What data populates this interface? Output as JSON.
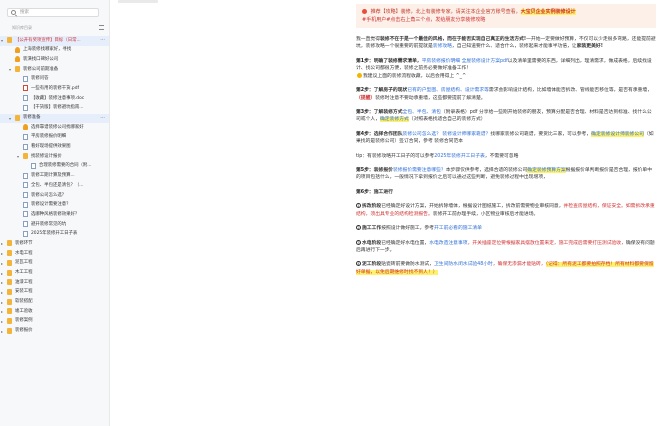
{
  "sidebar": {
    "search_placeholder": "搜索",
    "section_label": "知识库目录",
    "items": [
      {
        "label": "【公开有奖项宣传】目标（日常...",
        "icon": "folder-icon",
        "level": 0,
        "caret": "▾",
        "hl": true,
        "active": true
      },
      {
        "label": "上海装修找哪家好，寻找",
        "icon": "flame-icon",
        "level": 1
      },
      {
        "label": "装潢找口碑好公司",
        "icon": "flame-icon",
        "level": 1
      },
      {
        "label": "装修公司前期准备",
        "icon": "folder-icon",
        "level": 1,
        "caret": "▾"
      },
      {
        "label": "装修问答",
        "icon": "doc-icon",
        "level": 2
      },
      {
        "label": "一些有用的装修干货.pdf",
        "icon": "pdf-icon",
        "level": 2
      },
      {
        "label": "【收藏】装修注意事项.doc",
        "icon": "doc-icon",
        "level": 2
      },
      {
        "label": "【干货版】装修避坑指南...",
        "icon": "doc-icon",
        "level": 2
      },
      {
        "label": "装修准备",
        "icon": "folder-icon",
        "level": 1,
        "caret": "▾",
        "active": true
      },
      {
        "label": "选择靠谱装修公司找哪家好",
        "icon": "flame-icon",
        "level": 2
      },
      {
        "label": "平房装修报价明细",
        "icon": "doc-icon",
        "level": 2
      },
      {
        "label": "看好现场提供效果图",
        "icon": "doc-icon",
        "level": 2
      },
      {
        "label": "找装修设计报价",
        "icon": "folder-icon",
        "level": 2,
        "caret": "▾"
      },
      {
        "label": "合理装修需要的合同（附...",
        "icon": "doc-icon",
        "level": 3
      },
      {
        "label": "装修工期计算及预算...",
        "icon": "doc-icon",
        "level": 2
      },
      {
        "label": "全包、半包还是清包？（...",
        "icon": "doc-icon",
        "level": 2
      },
      {
        "label": "装修公司怎么选？",
        "icon": "doc-icon",
        "level": 2
      },
      {
        "label": "装修设计需要注意？",
        "icon": "doc-icon",
        "level": 2
      },
      {
        "label": "选哪种风格装修效果好？",
        "icon": "doc-icon",
        "level": 2
      },
      {
        "label": "避开装修常见的坑",
        "icon": "doc-icon",
        "level": 2
      },
      {
        "label": "2025年装修开工日子表",
        "icon": "doc-icon",
        "level": 2
      },
      {
        "label": "装修环节",
        "icon": "folder-icon",
        "level": 0,
        "caret": "▸"
      },
      {
        "label": "水电工程",
        "icon": "folder-icon",
        "level": 0,
        "caret": "▸"
      },
      {
        "label": "泥瓦工程",
        "icon": "folder-icon",
        "level": 0,
        "caret": "▸"
      },
      {
        "label": "木工工程",
        "icon": "folder-icon",
        "level": 0,
        "caret": "▸"
      },
      {
        "label": "油漆工程",
        "icon": "folder-icon",
        "level": 0,
        "caret": "▸"
      },
      {
        "label": "安装工程",
        "icon": "folder-icon",
        "level": 0,
        "caret": "▸"
      },
      {
        "label": "软装搭配",
        "icon": "folder-icon",
        "level": 0,
        "caret": "▸"
      },
      {
        "label": "竣工验收",
        "icon": "folder-icon",
        "level": 0,
        "caret": "▸"
      },
      {
        "label": "装修案例",
        "icon": "folder-icon",
        "level": 0,
        "caret": "▸"
      },
      {
        "label": "装修报价",
        "icon": "folder-icon",
        "level": 0,
        "caret": "▸"
      }
    ]
  },
  "notice": {
    "line1_prefix": "推荐【攻略】装修，北上有装修专家，请关注本企业官方账号查看，",
    "line1_highlight": "大宝贝企业实例装修设计",
    "line2": "#手机用户#点击右上角三个点，发给朋友分享装修攻略"
  },
  "intro": {
    "text_a": "我一直觉得",
    "bold_a": "装修不在于是一个最佳的风格，而在于能否实现自己真正的生活方式!",
    "text_b": "一开始一定要做好预算，不仅可以少走很多弯路，还能提前避坑，装修攻略一个很重要的前提就是",
    "link": "装修攻略",
    "text_c": "，自己知道要什么、适合什么，装修起来才能事半功倍，让",
    "bold_b": "家装更美好!"
  },
  "steps": [
    {
      "tag": "第1步：",
      "text": "明确了装修需求清单，",
      "links": "平房装修报价明细 全屋装修设计方案pdf",
      "rest": "以及清单里需要的东西，详细列出，理清需求，做成表格，后续找设计、找公司都很方便，装修之前务必要做好准备工作！",
      "extra": "我建议上面的装修流程收藏，以后会用得上 ^_^"
    },
    {
      "tag": "第2步：",
      "text": "了解房子的现状",
      "links": "已有的户型图、房屋结构、设计需求等",
      "rest": "需求会影响设计结构，比如墙体能否拆改、管线能否移位等，是否有承重墙，",
      "bold": "（提醒）",
      "rest2": "装修时注意不要动承重墙，这些都要提前了解清楚。"
    },
    {
      "tag": "第3步：",
      "text": "了解装修方式",
      "links": "全包、半包、清包",
      "rest": "（附录表格）pdf 分享给一些刚开始装修的朋友，预算分配是否合理、材料是否达到标准、找什么公司或个人，",
      "hl": "确定装修方式",
      "rest2": "（对照表格找适合自己的装修方式）"
    },
    {
      "tag": "第4步：",
      "text": "选择合作团队",
      "links": "装修公司怎么选？ 装修设计师哪家靠谱？",
      "rest": "找哪家装修公司靠谱，要货比三家，可以参考，",
      "hl": "确定装修设计师装修公司",
      "rest2": "（如果找的是装修公司）签订合同，参考 装修合同范本"
    },
    {
      "tip": "tip：有装修攻略开工日子的可以参考",
      "tip_link": "2025年装修开工日子表",
      "tip_rest": "，不需要可忽略"
    },
    {
      "tag": "第5步：",
      "text": "装修报价",
      "rest": "本步骤仅供参考，选择合适的装修公司",
      "links": "装修报价需要注意哪些？",
      "rest2": "根据报价单判断报价是否合理，报价单中的项目包括什么，一般情况下拿到报价之后可以通过这些判断，避免装修过程中出现增项，",
      "hl": "确定装修预算方案"
    },
    {
      "tag": "第6步：",
      "text": "施工进行",
      "sub": [
        {
          "n": "1",
          "title": "拆改阶段",
          "rest": "已经确定好设计方案，开始拆除墙体，根据设计图纸施工，拆改前需要物业审核同意，",
          "red": "并检查房屋结构，保证安全。如需拆改承重结构，须出具专业的结构检测报告。",
          "tail": "装修开工前办理手续，小区物业审核后才能进场。"
        },
        {
          "n": "2",
          "title": "施工工作",
          "rest": "按照设计做好施工，参考",
          "link": "开工前必看的施工清单"
        },
        {
          "n": "3",
          "title": "水电阶段",
          "rest": "已经确定好水电位置，",
          "link": "水电改造注意事项",
          "red": "，开关插座定位要根据家具摆放位置来定，施工完成后需要打压测试验收，",
          "tail": "确保没有问题后再进行下一步。"
        },
        {
          "n": "4",
          "title": "泥工阶段",
          "rest": "贴瓷砖前要做防水测试，",
          "link": "卫生间防水闭水试验48小时",
          "red": "，确保无渗漏才能贴砖，",
          "hl": "（记得：所有泥工都要拍照存档！所有材料都要保留好单据，以免后期维修时找不到人！）"
        }
      ]
    }
  ]
}
